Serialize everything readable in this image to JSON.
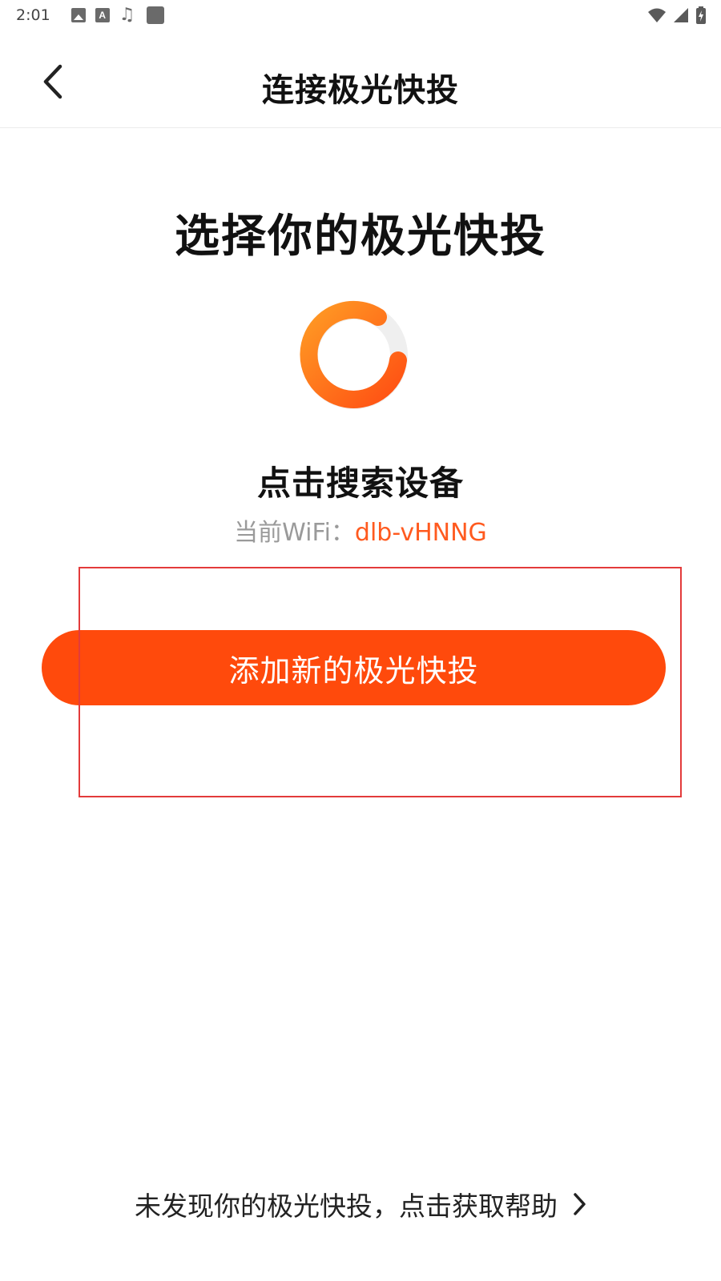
{
  "status_bar": {
    "time": "2:01",
    "icons": [
      "image-icon",
      "text-a-icon",
      "music-note-icon",
      "app-square-icon",
      "wifi-icon",
      "signal-icon",
      "battery-charging-icon"
    ]
  },
  "header": {
    "back_icon": "chevron-left-icon",
    "title": "连接极光快投"
  },
  "main": {
    "title": "选择你的极光快投",
    "loader_icon": "loading-spinner-icon",
    "search_label": "点击搜索设备",
    "wifi_prefix": "当前WiFi：",
    "wifi_name": "dlb-vHNNG"
  },
  "actions": {
    "add_button_label": "添加新的极光快投"
  },
  "footer": {
    "help_text": "未发现你的极光快投，点击获取帮助",
    "help_icon": "chevron-right-icon"
  },
  "colors": {
    "accent": "#ff4a0c",
    "wifi_name": "#ff5a1f",
    "spinner_start": "#ff9a24",
    "spinner_end": "#ff4f13",
    "highlight_box": "#e33b3b"
  }
}
